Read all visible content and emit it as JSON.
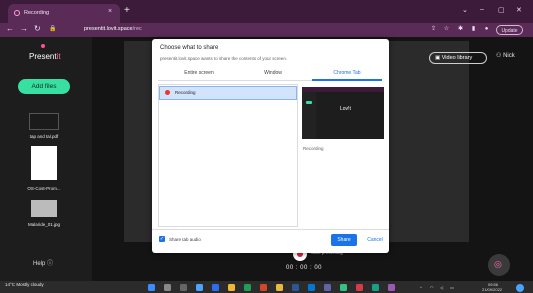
{
  "browser": {
    "tab_title": "Recording",
    "tab_close": "×",
    "new_tab": "+",
    "url_host": "presentit.lovit.space",
    "url_path": "/rec",
    "update_label": "Update",
    "window_controls": [
      "⌄",
      "–",
      "▢",
      "✕"
    ]
  },
  "app": {
    "logo_text": "Present",
    "logo_suffix": "it",
    "add_files_label": "Add files",
    "files": [
      {
        "name": "tap and tal.pdf",
        "icon": "dark-slide-icon"
      },
      {
        "name": "OS-Cost-Prom...",
        "icon": "document-icon"
      },
      {
        "name": "Malaride_01.jpg",
        "icon": "image-icon"
      }
    ],
    "help_label": "Help",
    "video_library_label": "Video library",
    "user_name": "Nick",
    "start_label": "Start presenting",
    "timer": "00 : 00 : 00"
  },
  "dialog": {
    "title": "Choose what to share",
    "subtitle": "presentit.lovit.space wants to share the contents of your screen.",
    "tabs": [
      "Entire screen",
      "Window",
      "Chrome Tab"
    ],
    "active_tab": "Chrome Tab",
    "items": [
      {
        "label": "Recording"
      }
    ],
    "preview_label": "Recording",
    "preview_logo": "Lov!t",
    "share_audio_label": "Share tab audio",
    "share_label": "Share",
    "cancel_label": "Cancel"
  },
  "taskbar": {
    "weather_temp": "14°C",
    "weather_text": "Mostly cloudy",
    "time": "09:56",
    "date": "21/09/2022"
  },
  "colors": {
    "accent_green": "#37e0a0",
    "brand_pink": "#ff6fb0",
    "record_red": "#e01f3d",
    "chrome_blue": "#1a73e8",
    "browser_frame": "#3b1a3a"
  }
}
